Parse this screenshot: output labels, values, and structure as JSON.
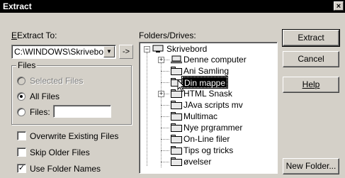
{
  "window": {
    "title": "Extract",
    "close_glyph": "×"
  },
  "extract_to": {
    "label": "Extract To:",
    "path_value": "C:\\WINDOWS\\Skrivebor",
    "arrow_glyph": "->"
  },
  "files_group": {
    "legend": "Files",
    "selected_files": "Selected Files",
    "all_files": "All Files",
    "files_label": "Files:",
    "files_value": ""
  },
  "options": {
    "overwrite": "Overwrite Existing Files",
    "skip_older": "Skip Older Files",
    "use_folder_names": "Use Folder Names",
    "overwrite_checked": false,
    "skip_older_checked": false,
    "use_folder_names_checked": true
  },
  "folders": {
    "label": "Folders/Drives:",
    "root": "Skrivebord",
    "items": [
      {
        "label": "Denne computer",
        "icon": "computer-icon",
        "expandable": true
      },
      {
        "label": "Ani Samling",
        "icon": "folder-icon",
        "expandable": false
      },
      {
        "label": "Din mappe",
        "icon": "folder-icon",
        "expandable": false,
        "selected": true
      },
      {
        "label": "HTML Snask",
        "icon": "folder-icon",
        "expandable": true
      },
      {
        "label": "JAva scripts mv",
        "icon": "folder-icon",
        "expandable": false
      },
      {
        "label": "Multimac",
        "icon": "folder-icon",
        "expandable": false
      },
      {
        "label": "Nye prgrammer",
        "icon": "folder-icon",
        "expandable": false
      },
      {
        "label": "On-Line filer",
        "icon": "folder-icon",
        "expandable": false
      },
      {
        "label": "Tips og tricks",
        "icon": "folder-icon",
        "expandable": false
      },
      {
        "label": "øvelser",
        "icon": "folder-icon",
        "expandable": false
      }
    ]
  },
  "buttons": {
    "extract": "Extract",
    "cancel": "Cancel",
    "help": "Help",
    "new_folder": "New Folder..."
  }
}
